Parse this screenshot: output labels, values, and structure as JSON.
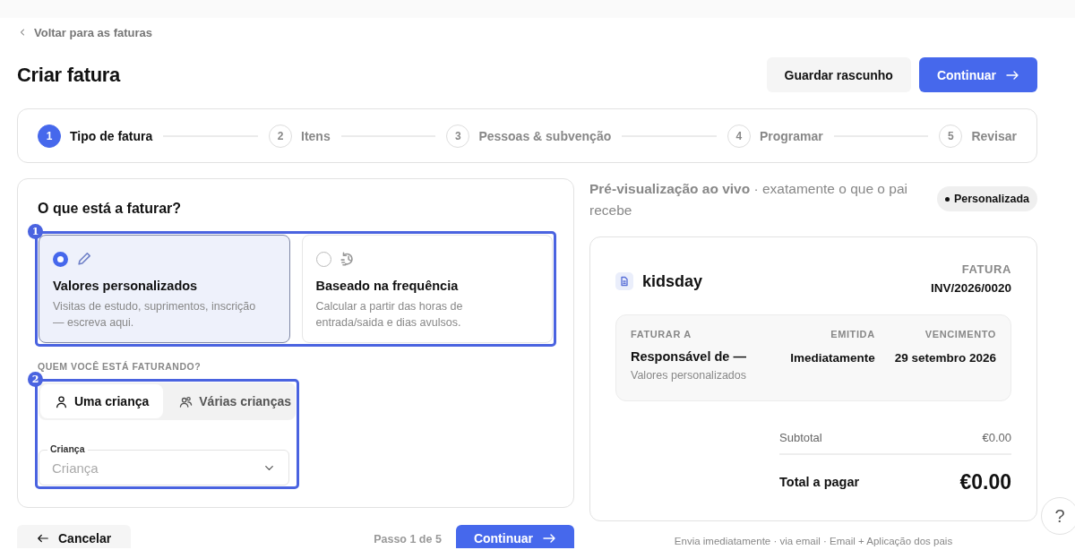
{
  "back_link": {
    "label": "Voltar para as faturas"
  },
  "page_title": "Criar fatura",
  "header_buttons": [
    {
      "label": "Guardar rascunho",
      "kind": "secondary"
    },
    {
      "label": "Continuar",
      "kind": "primary"
    }
  ],
  "steps": [
    {
      "number": "1",
      "label": "Tipo de fatura",
      "selected": true
    },
    {
      "number": "2",
      "label": "Itens",
      "selected": false
    },
    {
      "number": "3",
      "label": "Pessoas & subvenção",
      "selected": false
    },
    {
      "number": "4",
      "label": "Programar",
      "selected": false
    },
    {
      "number": "5",
      "label": "Revisar",
      "selected": false
    }
  ],
  "form": {
    "question": "O que está a faturar?",
    "type_marker": "1",
    "invoice_types": [
      {
        "title": "Valores personalizados",
        "description": "Visitas de estudo, suprimentos, inscrição — escreva aqui.",
        "selected": true
      },
      {
        "title": "Baseado na frequência",
        "description": "Calcular a partir das horas de entrada/saida e dias avulsos.",
        "selected": false
      }
    ],
    "recipient_label": "QUEM VOCÊ ESTÁ FATURANDO?",
    "recipient_marker": "2",
    "recipient_modes": [
      {
        "label": "Uma criança",
        "selected": true
      },
      {
        "label": "Várias crianças",
        "selected": false
      }
    ],
    "child_field": {
      "label": "Criança",
      "placeholder": "Criança"
    }
  },
  "footer": {
    "cancel": "Cancelar",
    "progress": "Passo 1 de 5",
    "continue": "Continuar"
  },
  "preview": {
    "title": "**Pré-visualização ao vivo** · exatamente o que o pai recebe",
    "badge": "Personalizada",
    "invoice": {
      "brand": "kidsday",
      "doc_label": "FATURA",
      "number": "INV/2026/0020",
      "bill_to_label": "FATURAR A",
      "bill_to_name": "Responsável de —",
      "bill_to_note": "Valores personalizados",
      "issued_label": "EMITIDA",
      "issued": "Imediatamente",
      "due_label": "VENCIMENTO",
      "due": "29 setembro 2026",
      "subtotal_label": "Subtotal",
      "subtotal": "€0.00",
      "total_label": "Total a pagar",
      "total": "€0.00"
    },
    "delivery_note": "Envia imediatamente · via email · Email + Aplicação dos pais"
  },
  "help_button": {
    "label": "?"
  }
}
